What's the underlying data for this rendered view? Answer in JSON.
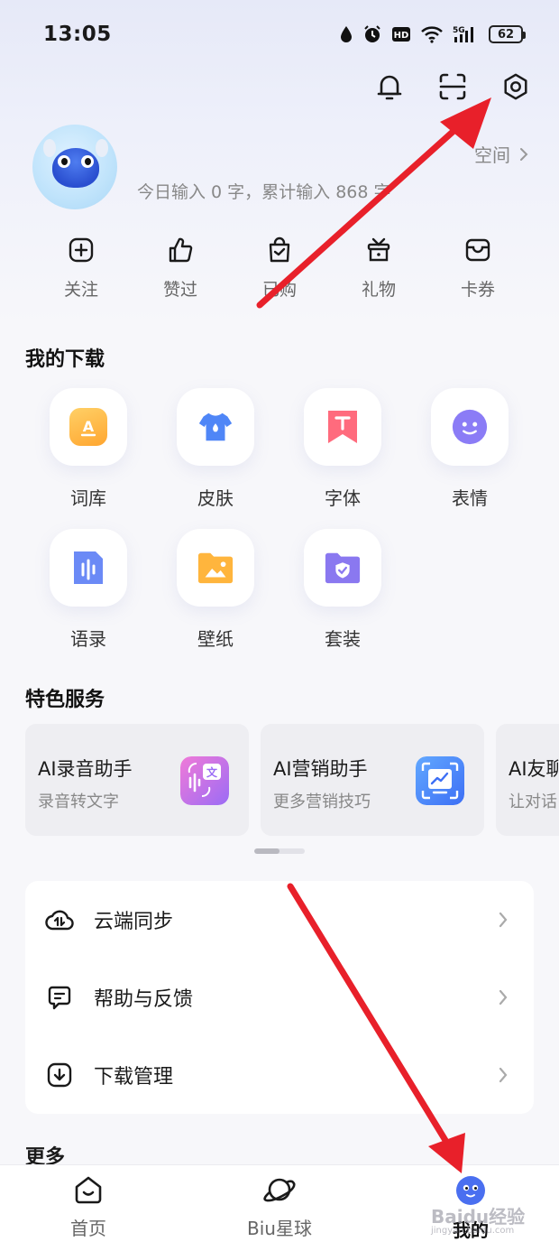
{
  "status_bar": {
    "time": "13:05",
    "battery": "62",
    "network": "5G"
  },
  "profile": {
    "space_label": "空间",
    "input_stats": "今日输入 0 字，累计输入 868 字"
  },
  "quick_actions": [
    {
      "label": "关注",
      "icon": "plus-box-icon"
    },
    {
      "label": "赞过",
      "icon": "thumbs-up-icon"
    },
    {
      "label": "已购",
      "icon": "shopping-bag-icon"
    },
    {
      "label": "礼物",
      "icon": "gift-icon"
    },
    {
      "label": "卡券",
      "icon": "coupon-icon"
    }
  ],
  "downloads": {
    "title": "我的下载",
    "items": [
      {
        "label": "词库",
        "icon": "lexicon-icon",
        "color": "#ffb340"
      },
      {
        "label": "皮肤",
        "icon": "skin-shirt-icon",
        "color": "#4f86f7"
      },
      {
        "label": "字体",
        "icon": "font-icon",
        "color": "#ff6b7d"
      },
      {
        "label": "表情",
        "icon": "emoji-icon",
        "color": "#8b7cf6"
      },
      {
        "label": "语录",
        "icon": "quote-doc-icon",
        "color": "#6b8af6"
      },
      {
        "label": "壁纸",
        "icon": "wallpaper-folder-icon",
        "color": "#ffb53d"
      },
      {
        "label": "套装",
        "icon": "bundle-folder-icon",
        "color": "#8a78f0"
      }
    ]
  },
  "services": {
    "title": "特色服务",
    "items": [
      {
        "title": "AI录音助手",
        "subtitle": "录音转文字",
        "icon": "ai-translate-icon"
      },
      {
        "title": "AI营销助手",
        "subtitle": "更多营销技巧",
        "icon": "ai-marketing-icon"
      },
      {
        "title": "AI友聊",
        "subtitle": "让对话",
        "icon": "ai-chat-icon"
      }
    ]
  },
  "menu": {
    "items": [
      {
        "label": "云端同步",
        "icon": "cloud-sync-icon"
      },
      {
        "label": "帮助与反馈",
        "icon": "feedback-icon"
      },
      {
        "label": "下载管理",
        "icon": "download-manage-icon"
      }
    ]
  },
  "more_title": "更多",
  "bottom_nav": {
    "items": [
      {
        "label": "首页",
        "icon": "home-icon"
      },
      {
        "label": "Biu星球",
        "icon": "planet-icon"
      },
      {
        "label": "我的",
        "icon": "profile-avatar-icon",
        "active": true
      }
    ]
  },
  "watermark": {
    "text": "Baidu经验",
    "sub": "jingyan.baidu.com"
  }
}
